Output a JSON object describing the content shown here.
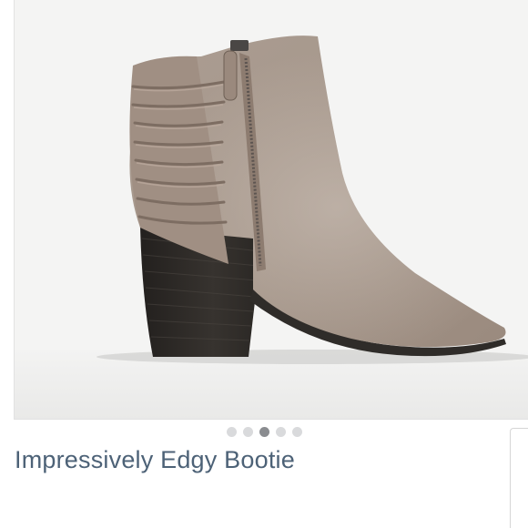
{
  "product": {
    "title": "Impressively Edgy Bootie",
    "image_alt": "Taupe suede fringe ankle bootie with side zipper and stacked block heel"
  },
  "carousel": {
    "total": 5,
    "active_index": 2
  },
  "colors": {
    "title": "#4d6277",
    "dot_inactive": "#d9dadc",
    "dot_active": "#8a8c90",
    "suede": "#a7978b",
    "heel": "#2e2b28",
    "photo_bg": "#f3f3f2"
  }
}
